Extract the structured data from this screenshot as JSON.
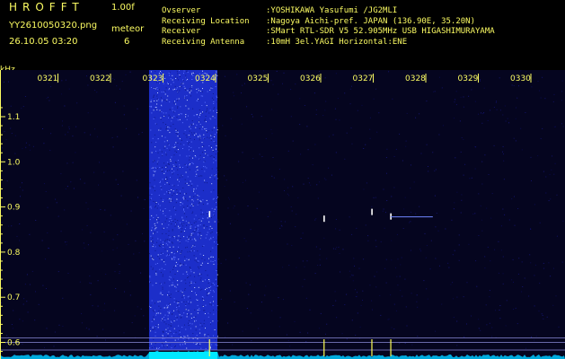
{
  "header": {
    "app_name": "HROFFT",
    "app_version": "1.00f",
    "file_name": "YY2610050320.png",
    "mode_label": "meteor",
    "datetime": "26.10.05 03:20",
    "count": "6"
  },
  "info": [
    {
      "label": "Ovserver",
      "value": ":YOSHIKAWA Yasufumi /JG2MLI"
    },
    {
      "label": "Receiving Location",
      "value": ":Nagoya Aichi-pref. JAPAN (136.90E, 35.20N)"
    },
    {
      "label": "Receiver",
      "value": ":SMart RTL-SDR V5 52.905MHz USB HIGASHIMURAYAMA"
    },
    {
      "label": "Receiving Antenna",
      "value": ":10mH 3el.YAGI Horizontal:ENE"
    }
  ],
  "colors": {
    "text": "#fbfb62",
    "background": "#000000",
    "noise_floor": "#0b0b3f",
    "echo_band": "#2233d8",
    "baseline": "#00e8ff"
  },
  "chart_data": {
    "type": "heatmap",
    "y_unit_label": "kHz",
    "x_ticks": [
      "0321",
      "0322",
      "0323",
      "0324",
      "0325",
      "0326",
      "0327",
      "0328",
      "0329",
      "0330"
    ],
    "x_range_min": [
      0,
      10
    ],
    "y_ticks": [
      "1.1",
      "1.0",
      "0.9",
      "0.8",
      "0.7",
      "0.6"
    ],
    "y_range_khz": [
      0.55,
      1.15
    ],
    "reference_lines_khz": [
      0.61,
      0.6
    ],
    "strong_band": {
      "from_min": 2.7,
      "to_min": 4.0
    },
    "meteor_echoes": [
      {
        "time_min": 3.85,
        "freq_khz": 0.885
      },
      {
        "time_min": 6.03,
        "freq_khz": 0.875
      },
      {
        "time_min": 6.94,
        "freq_khz": 0.89
      },
      {
        "time_min": 7.3,
        "freq_khz": 0.88,
        "trail_to_min": 8.1
      }
    ]
  }
}
